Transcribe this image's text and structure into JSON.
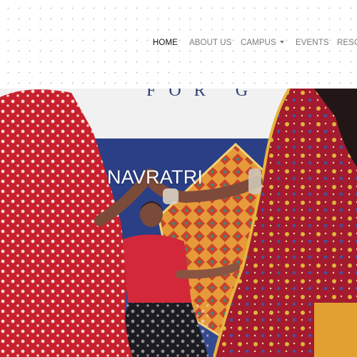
{
  "nav": {
    "items": [
      {
        "label": "HOME",
        "active": true
      },
      {
        "label": "ABOUT US",
        "active": false
      },
      {
        "label": "CAMPUS",
        "active": false,
        "has_dropdown": true
      },
      {
        "label": "EVENTS",
        "active": false
      },
      {
        "label": "RESOU",
        "active": false
      }
    ]
  },
  "hero": {
    "title": "NAVRATRI",
    "banner_text": "FOR G"
  },
  "colors": {
    "active_nav": "#111111",
    "inactive_nav": "#7a7a7a",
    "hero_title": "#ffffff",
    "stage_backdrop": "#2a3f86",
    "banner": "#f1f1f1"
  }
}
